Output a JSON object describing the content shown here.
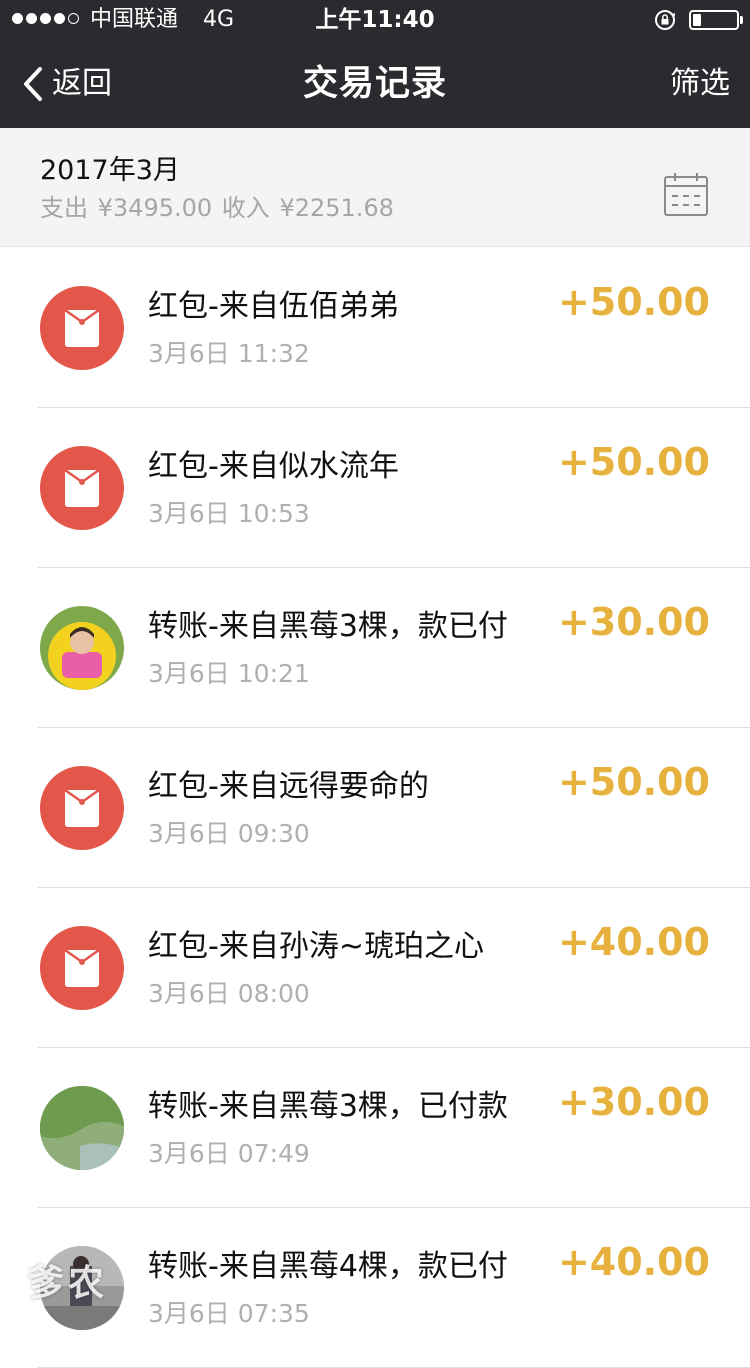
{
  "status_bar": {
    "carrier": "中国联通",
    "network": "4G",
    "time": "上午11:40",
    "signal_bars_filled": 4,
    "signal_bars_total": 5,
    "battery_level": 0.2
  },
  "nav": {
    "back_label": "返回",
    "title": "交易记录",
    "filter_label": "筛选"
  },
  "month": {
    "title": "2017年3月",
    "expense_label": "支出",
    "expense_amount": "¥3495.00",
    "income_label": "收入",
    "income_amount": "¥2251.68"
  },
  "transactions": [
    {
      "title": "红包-来自伍佰弟弟",
      "date": "3月6日 11:32",
      "amount": "+50.00",
      "avatar": "red-packet-icon"
    },
    {
      "title": "红包-来自似水流年",
      "date": "3月6日 10:53",
      "amount": "+50.00",
      "avatar": "red-packet-icon"
    },
    {
      "title": "转账-来自黑莓3棵，款已付",
      "date": "3月6日 10:21",
      "amount": "+30.00",
      "avatar": "user-avatar"
    },
    {
      "title": "红包-来自远得要命的",
      "date": "3月6日 09:30",
      "amount": "+50.00",
      "avatar": "red-packet-icon"
    },
    {
      "title": "红包-来自孙涛~琥珀之心",
      "date": "3月6日 08:00",
      "amount": "+40.00",
      "avatar": "red-packet-icon"
    },
    {
      "title": "转账-来自黑莓3棵，已付款",
      "date": "3月6日 07:49",
      "amount": "+30.00",
      "avatar": "user-avatar"
    },
    {
      "title": "转账-来自黑莓4棵，款已付",
      "date": "3月6日 07:35",
      "amount": "+40.00",
      "avatar": "user-avatar"
    }
  ],
  "watermark": "爹农",
  "colors": {
    "nav_background": "#2b2a2f",
    "amount": "#e6b13c",
    "red_packet": "#e2574a",
    "header_background": "#f4f4f4"
  }
}
